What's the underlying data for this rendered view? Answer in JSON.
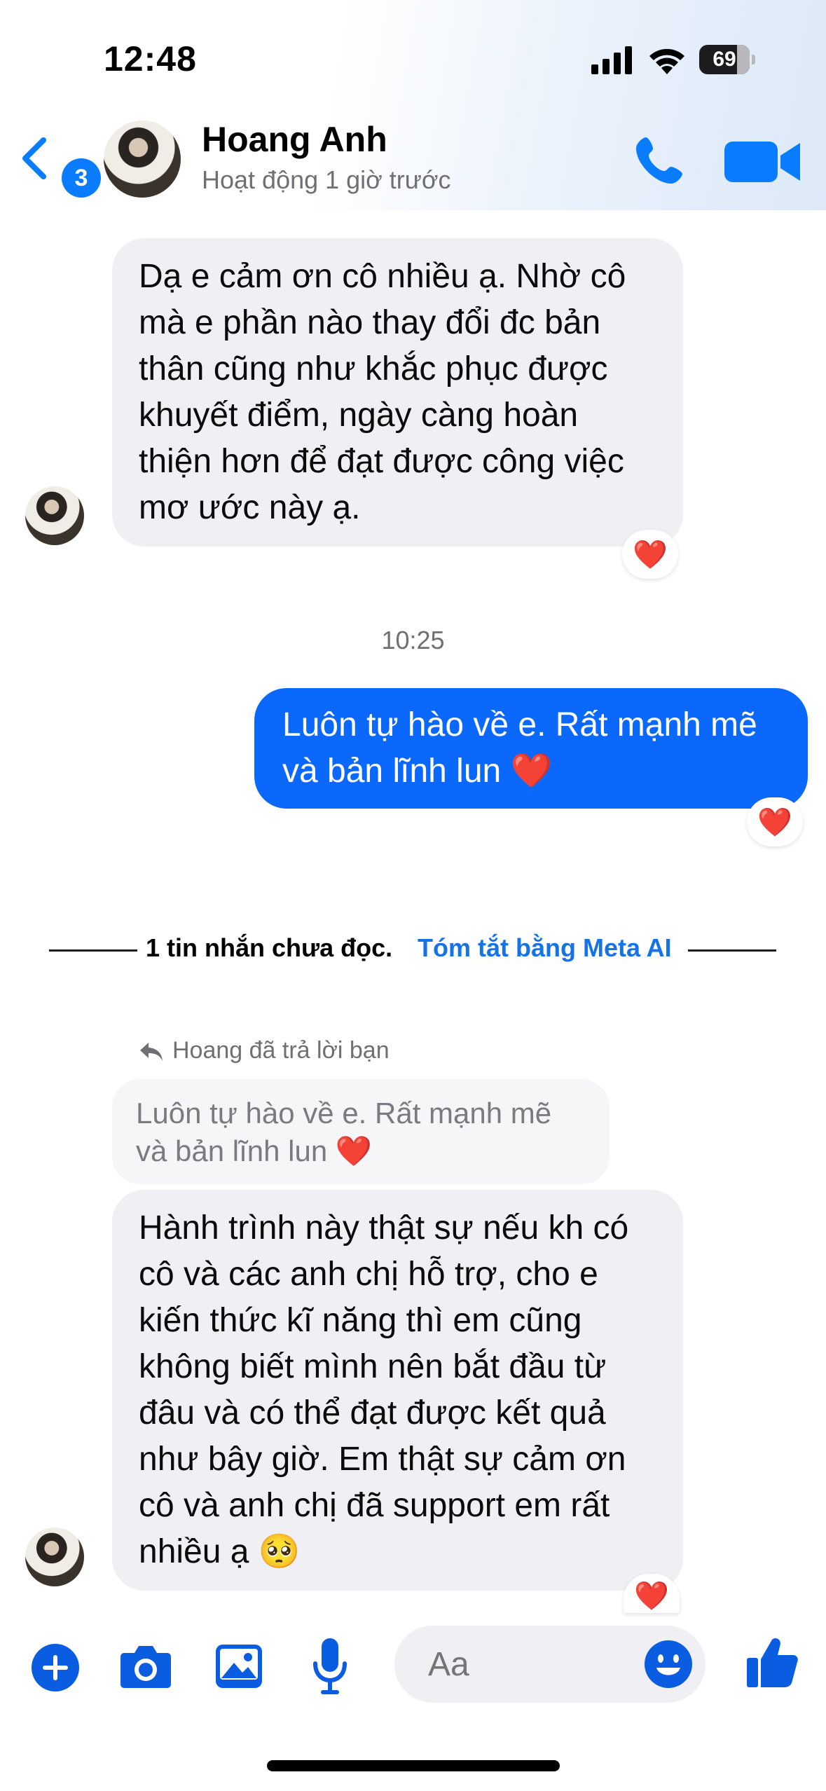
{
  "status_bar": {
    "time": "12:48",
    "battery": "69"
  },
  "header": {
    "back_badge": "3",
    "contact_name": "Hoang Anh",
    "contact_status": "Hoạt động 1 giờ trước"
  },
  "messages": {
    "m1_lines": [
      "Dạ e cảm ơn cô nhiều ạ. Nhờ cô",
      "mà e phần nào thay đổi đc bản",
      "thân cũng như khắc phục được",
      "khuyết điểm, ngày càng hoàn",
      "thiện hơn để đạt được công việc",
      "mơ ước này ạ."
    ],
    "m1_reaction": "❤️",
    "timestamp": "10:25",
    "m2_lines": [
      "Luôn tự hào về e. Rất mạnh mẽ",
      "và bản lĩnh lun ❤️"
    ],
    "m2_reaction": "❤️",
    "unread_text": "1 tin nhắn chưa đọc.",
    "meta_ai_link": "Tóm tắt bằng Meta AI",
    "reply_label": "Hoang đã trả lời bạn",
    "reply_quote_lines": [
      "Luôn tự hào về e. Rất mạnh mẽ",
      "và bản lĩnh lun ❤️"
    ],
    "m3_lines": [
      "Hành trình này thật sự nếu kh có",
      "cô và các anh chị hỗ trợ, cho e",
      "kiến thức kĩ năng thì em cũng",
      "không biết mình nên bắt đầu từ",
      "đâu và có thể đạt được kết quả",
      "như bây giờ. Em thật sự cảm ơn",
      "cô và anh chị đã support em rất",
      "nhiều ạ 🥺"
    ],
    "m3_reaction": "❤️"
  },
  "composer": {
    "placeholder": "Aa"
  },
  "colors": {
    "accent": "#0a7cff",
    "outgoing_bubble": "#0a68fd",
    "incoming_bubble": "#f0f0f4"
  },
  "icons": [
    "signal-icon",
    "wifi-icon",
    "battery-icon",
    "back-chevron-icon",
    "phone-icon",
    "video-camera-icon",
    "reply-arrow-icon",
    "plus-icon",
    "camera-icon",
    "image-icon",
    "microphone-icon",
    "emoji-icon",
    "thumbs-up-icon"
  ]
}
